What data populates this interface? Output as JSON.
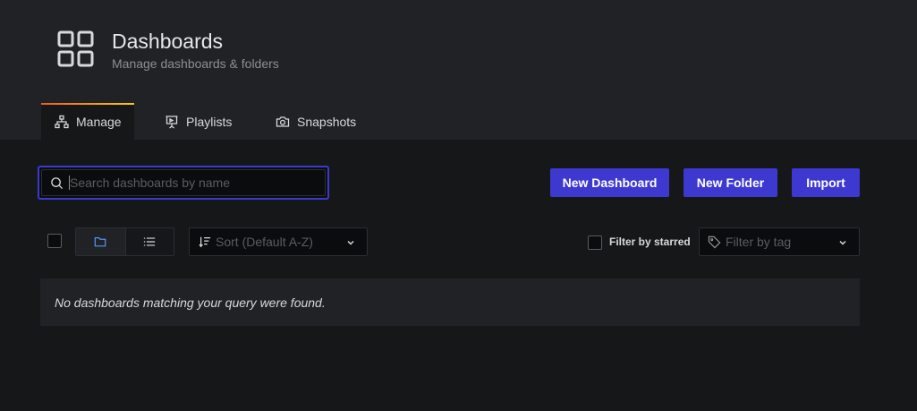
{
  "header": {
    "title": "Dashboards",
    "subtitle": "Manage dashboards & folders",
    "icon": "apps-grid-icon"
  },
  "tabs": [
    {
      "label": "Manage",
      "icon": "sitemap-icon",
      "active": true
    },
    {
      "label": "Playlists",
      "icon": "presentation-icon",
      "active": false
    },
    {
      "label": "Snapshots",
      "icon": "camera-icon",
      "active": false
    }
  ],
  "search": {
    "placeholder": "Search dashboards by name",
    "value": ""
  },
  "actions": {
    "new_dashboard": "New Dashboard",
    "new_folder": "New Folder",
    "import": "Import"
  },
  "filters": {
    "sort_placeholder": "Sort (Default A-Z)",
    "starred_label": "Filter by starred",
    "tag_placeholder": "Filter by tag"
  },
  "results": {
    "empty_message": "No dashboards matching your query were found."
  },
  "colors": {
    "primary": "#3d39d0",
    "page_bg": "#161719",
    "header_bg": "#202226",
    "tab_accent_start": "#f05a28",
    "tab_accent_end": "#fbca0a"
  }
}
